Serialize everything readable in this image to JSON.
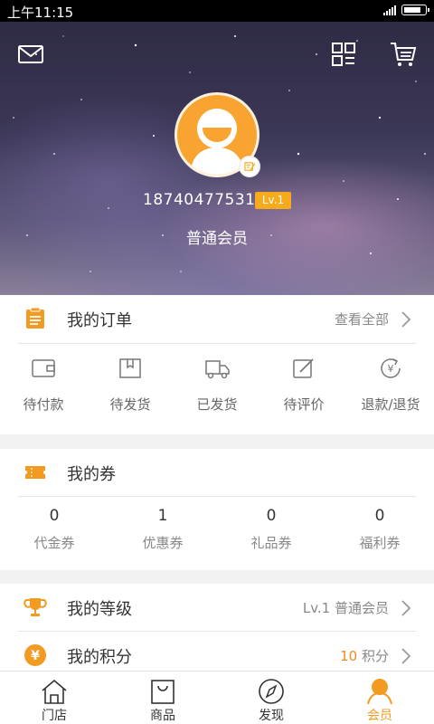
{
  "status_bar": {
    "time": "上午11:15"
  },
  "profile": {
    "phone": "18740477531",
    "level": "Lv.1",
    "member_type": "普通会员"
  },
  "orders": {
    "title": "我的订单",
    "view_all": "查看全部",
    "items": [
      {
        "label": "待付款",
        "icon": "wallet-icon"
      },
      {
        "label": "待发货",
        "icon": "package-icon"
      },
      {
        "label": "已发货",
        "icon": "truck-icon"
      },
      {
        "label": "待评价",
        "icon": "edit-icon"
      },
      {
        "label": "退款/退货",
        "icon": "refund-icon"
      }
    ]
  },
  "coupons": {
    "title": "我的券",
    "items": [
      {
        "count": "0",
        "label": "代金券"
      },
      {
        "count": "1",
        "label": "优惠券"
      },
      {
        "count": "0",
        "label": "礼品券"
      },
      {
        "count": "0",
        "label": "福利券"
      }
    ]
  },
  "level": {
    "title": "我的等级",
    "value": "Lv.1 普通会员"
  },
  "points": {
    "title": "我的积分",
    "value": "10",
    "unit": " 积分"
  },
  "tabs": [
    {
      "label": "门店",
      "icon": "store-icon"
    },
    {
      "label": "商品",
      "icon": "shopping-bag-icon"
    },
    {
      "label": "发现",
      "icon": "compass-icon"
    },
    {
      "label": "会员",
      "icon": "member-icon",
      "active": true
    }
  ],
  "colors": {
    "accent": "#f39a21",
    "level_tag": "#f6ab1c",
    "points": "#f08a1c"
  }
}
